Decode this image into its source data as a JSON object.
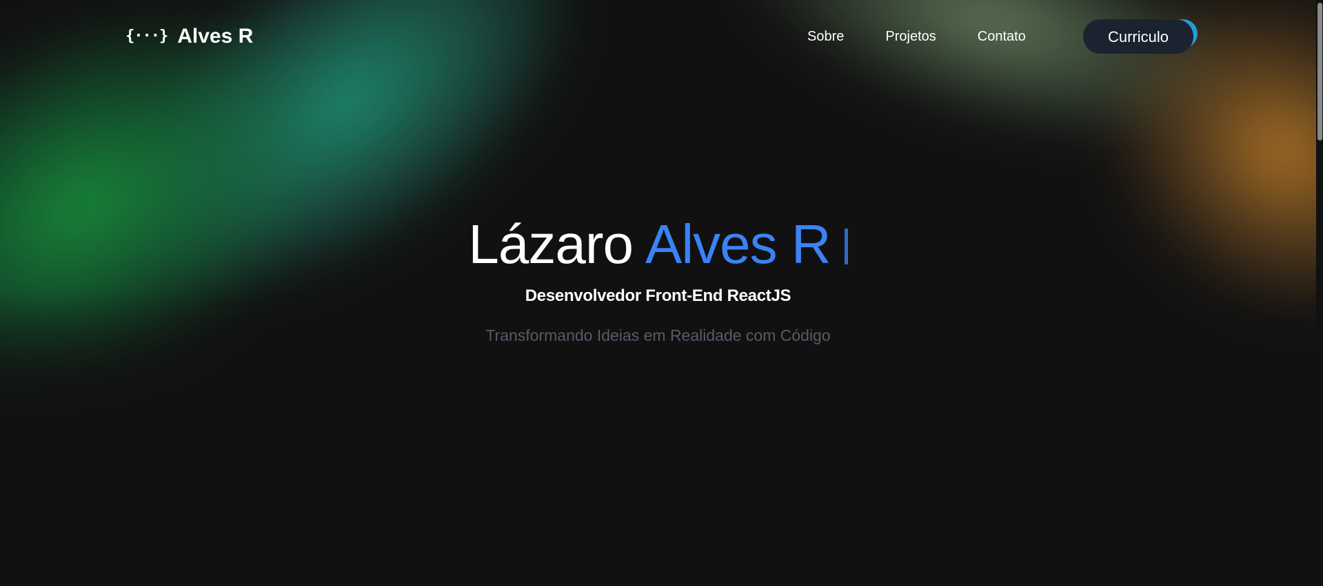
{
  "header": {
    "logo_icon": "{···}",
    "logo_text": "Alves R",
    "nav": [
      {
        "label": "Sobre"
      },
      {
        "label": "Projetos"
      },
      {
        "label": "Contato"
      }
    ],
    "cta_label": "Curriculo"
  },
  "hero": {
    "first_name": "Lázaro",
    "last_name": "Alves R",
    "role": "Desenvolvedor Front-End ReactJS",
    "tagline": "Transformando Ideias em Realidade com Código"
  },
  "colors": {
    "background": "#111111",
    "accent": "#3b82f6",
    "button": "#1b2331",
    "muted_text": "#555b68"
  }
}
